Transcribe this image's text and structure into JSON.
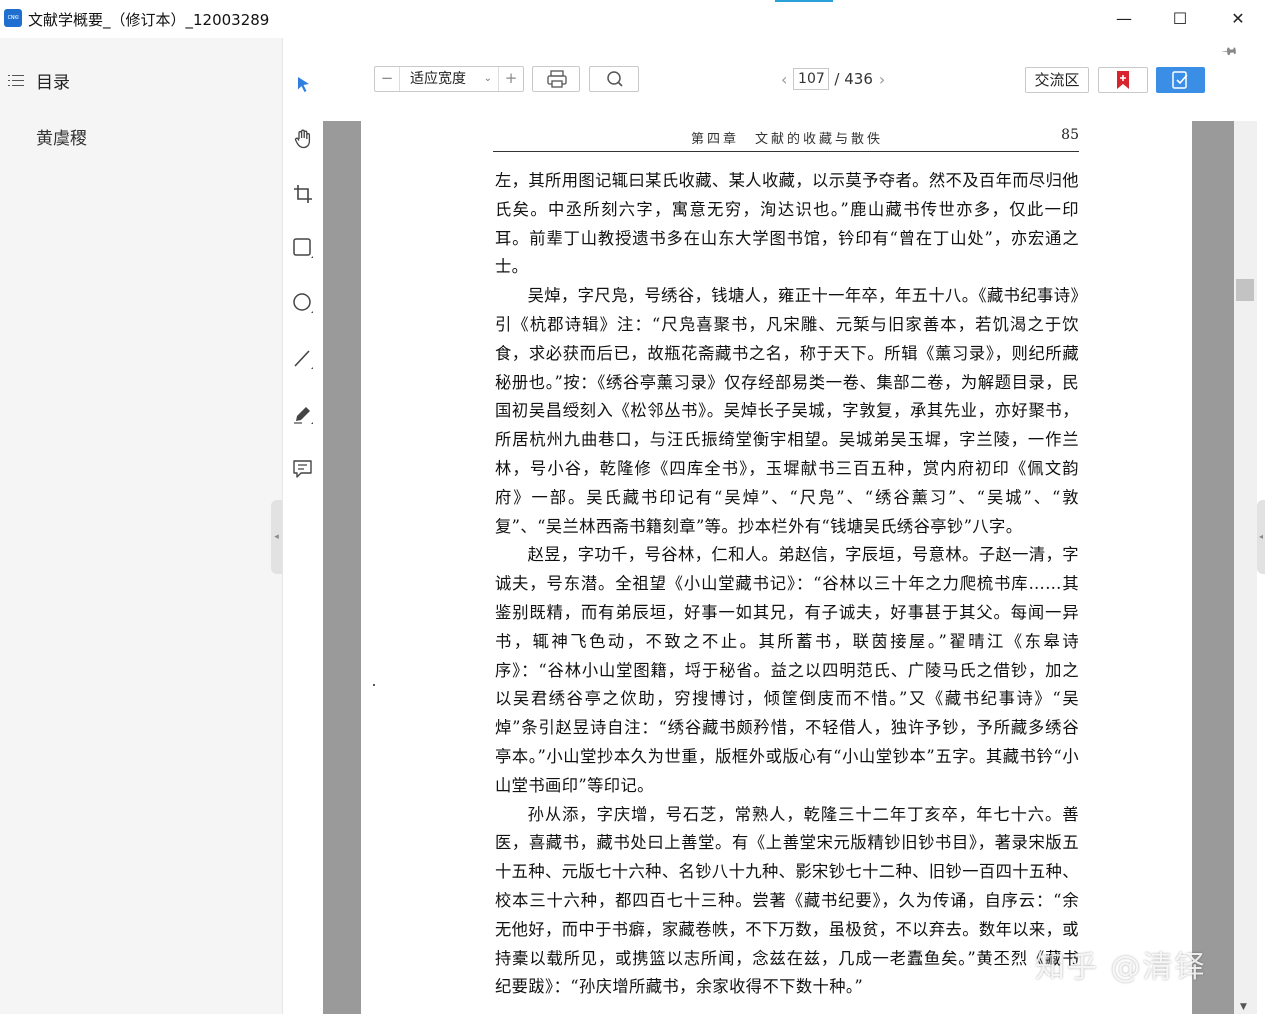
{
  "window": {
    "title": "文献学概要_（修订本）_12003289",
    "logo_text": "CNKI",
    "minimize_glyph": "—",
    "maximize_glyph": "☐",
    "close_glyph": "✕"
  },
  "sidebar": {
    "heading": "目录",
    "entries": [
      {
        "label": "黄虞稷"
      }
    ],
    "collapse_glyph": "◂"
  },
  "tools": [
    {
      "name": "select-tool",
      "icon": "pointer-icon",
      "active": true
    },
    {
      "name": "hand-tool",
      "icon": "hand-icon"
    },
    {
      "name": "crop-tool",
      "icon": "crop-icon"
    },
    {
      "name": "rectangle-tool",
      "icon": "rectangle-icon"
    },
    {
      "name": "circle-tool",
      "icon": "circle-icon"
    },
    {
      "name": "line-tool",
      "icon": "line-icon"
    },
    {
      "name": "pen-tool",
      "icon": "pen-icon"
    },
    {
      "name": "comment-tool",
      "icon": "comment-icon"
    }
  ],
  "toolbar": {
    "zoom_minus": "−",
    "zoom_value": "适应宽度",
    "zoom_plus": "+",
    "current_page": "107",
    "total_pages": "/ 436",
    "prev_glyph": "‹",
    "next_glyph": "›",
    "exchange_label": "交流区",
    "accent_color": "#3a8ee6",
    "bookmark_color": "#d8242f"
  },
  "page": {
    "running_title": "第四章　文献的收藏与散佚",
    "page_number": "85",
    "paragraphs": [
      {
        "indent": false,
        "text": "左，其所用图记辄曰某氏收藏、某人收藏，以示莫予夺者。然不及百年而尽归他氏矣。中丞所刻六字，寓意无穷，洵达识也。”鹿山藏书传世亦多，仅此一印耳。前辈丁山教授遗书多在山东大学图书馆，钤印有“曾在丁山处”，亦宏通之士。"
      },
      {
        "indent": true,
        "text": "吴焯，字尺凫，号绣谷，钱塘人，雍正十一年卒，年五十八。《藏书纪事诗》引《杭郡诗辑》注：“尺凫喜聚书，凡宋雕、元椠与旧家善本，若饥渴之于饮食，求必获而后已，故瓶花斋藏书之名，称于天下。所辑《薰习录》，则纪所藏秘册也。”按：《绣谷亭薰习录》仅存经部易类一卷、集部二卷，为解题目录，民国初吴昌绶刻入《松邻丛书》。吴焯长子吴城，字敦复，承其先业，亦好聚书，所居杭州九曲巷口，与汪氏振绮堂衡宇相望。吴城弟吴玉墀，字兰陵，一作兰林，号小谷，乾隆修《四库全书》，玉墀献书三百五种，赏内府初印《佩文韵府》一部。吴氏藏书印记有“吴焯”、“尺凫”、“绣谷薰习”、“吴城”、“敦复”、“吴兰林西斋书籍刻章”等。抄本栏外有“钱塘吴氏绣谷亭钞”八字。"
      },
      {
        "indent": true,
        "text": "赵昱，字功千，号谷林，仁和人。弟赵信，字辰垣，号意林。子赵一清，字诚夫，号东潜。全祖望《小山堂藏书记》：“谷林以三十年之力爬梳书库……其鉴别既精，而有弟辰垣，好事一如其兄，有子诚夫，好事甚于其父。每闻一异书，辄神飞色动，不致之不止。其所蓄书，联茵接屋。”翟晴江《东皋诗序》：“谷林小山堂图籍，埒于秘省。益之以四明范氏、广陵马氏之借钞，加之以吴君绣谷亭之佽助，穷搜博讨，倾筐倒庋而不惜。”又《藏书纪事诗》“吴焯”条引赵昱诗自注：“绣谷藏书颇矜惜，不轻借人，独许予钞，予所藏多绣谷亭本。”小山堂抄本久为世重，版框外或版心有“小山堂钞本”五字。其藏书钤“小山堂书画印”等印记。"
      },
      {
        "indent": true,
        "text": "孙从添，字庆增，号石芝，常熟人，乾隆三十二年丁亥卒，年七十六。善医，喜藏书，藏书处曰上善堂。有《上善堂宋元版精钞旧钞书目》，著录宋版五十五种、元版七十六种、名钞八十九种、影宋钞七十二种、旧钞一百四十五种、校本三十六种，都四百七十三种。尝著《藏书纪要》，久为传诵，自序云：“余无他好，而中于书癖，家藏卷帙，不下万数，虽极贫，不以弃去。数年以来，或持橐以载所见，或携篮以志所闻，念兹在兹，几成一老蠹鱼矣。”黄丕烈《藏书纪要跋》：“孙庆增所藏书，余家收得不下数十种。”"
      }
    ]
  },
  "watermark": "知乎 @清铎"
}
